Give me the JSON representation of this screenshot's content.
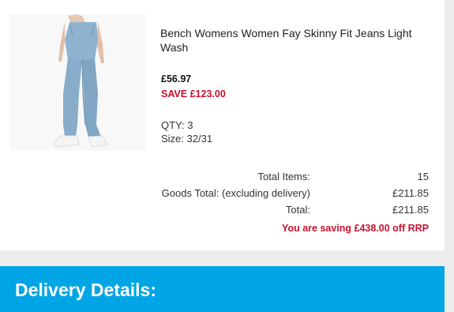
{
  "product": {
    "image_alt": "jeans-product-image",
    "title": "Bench Womens Women Fay Skinny Fit Jeans Light Wash",
    "price": "£56.97",
    "save": "SAVE £123.00",
    "qty": "QTY: 3",
    "size": "Size: 32/31"
  },
  "totals": {
    "rows": [
      {
        "label": "Total Items:",
        "value": "15"
      },
      {
        "label": "Goods Total: (excluding delivery)",
        "value": "£211.85"
      },
      {
        "label": "Total:",
        "value": "£211.85"
      }
    ],
    "saving": "You are saving £438.00 off RRP"
  },
  "delivery": {
    "heading": "Delivery Details:"
  },
  "colors": {
    "accent_blue": "#00a5e6",
    "sale_red": "#c8102e",
    "background_grey": "#ececec"
  }
}
